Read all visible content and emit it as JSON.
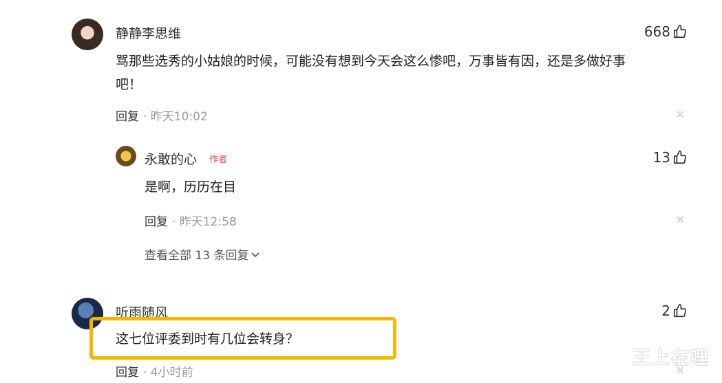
{
  "comments": [
    {
      "username": "静静李思维",
      "likes": "668",
      "text_line1": "骂那些选秀的小姑娘的时候，可能没有想到今天会这么惨吧，万事皆有因，还是多做好事",
      "text_line2": "吧！",
      "reply_label": "回复",
      "time": "· 昨天10:02"
    },
    {
      "username": "听雨随风",
      "likes": "2",
      "text": "这七位评委到时有几位会转身？",
      "reply_label": "回复",
      "time": "· 4小时前"
    }
  ],
  "reply": {
    "username": "永敢的心",
    "author_tag": "作者",
    "likes": "13",
    "text": "是啊，历历在目",
    "reply_label": "回复",
    "time": "· 昨天12:58",
    "view_all": "查看全部 13 条回复"
  },
  "watermark": "王上在哩",
  "colors": {
    "highlight_border": "#f5b800",
    "author_tag": "#e0483a"
  }
}
